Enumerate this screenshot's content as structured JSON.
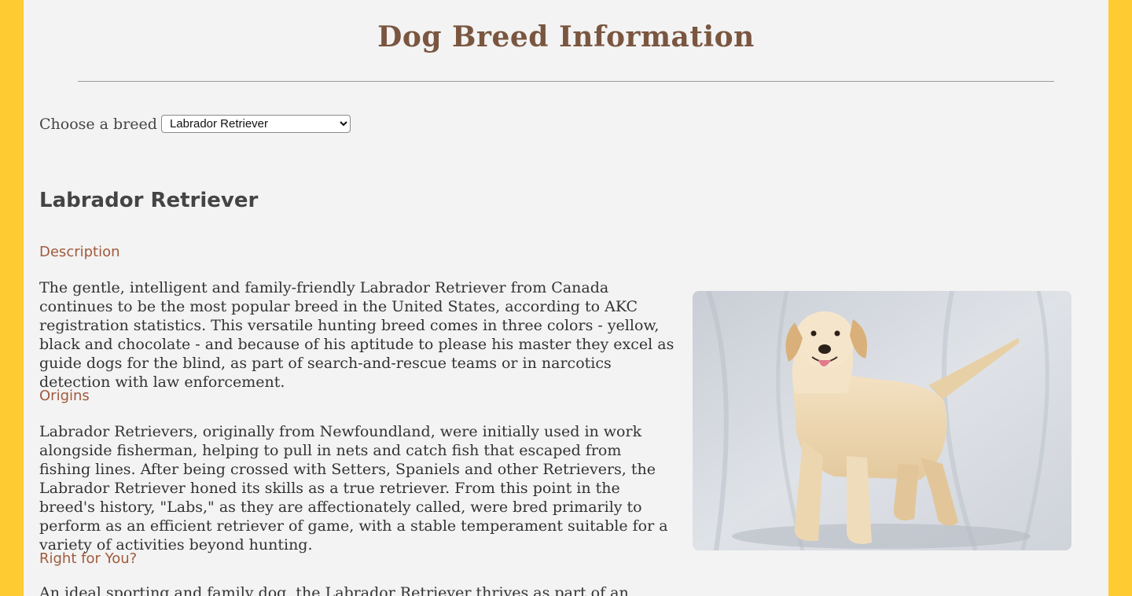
{
  "header": {
    "title": "Dog Breed Information"
  },
  "chooser": {
    "label": "Choose a breed",
    "selected": "Labrador Retriever"
  },
  "breed": {
    "name": "Labrador Retriever",
    "sections": {
      "description": {
        "heading": "Description",
        "body": "The gentle, intelligent and family-friendly Labrador Retriever from Canada continues to be the most popular breed in the United States, according to AKC registration statistics. This versatile hunting breed comes in three colors - yellow, black and chocolate - and because of his aptitude to please his master they excel as guide dogs for the blind, as part of search-and-rescue teams or in narcotics detection with law enforcement."
      },
      "origins": {
        "heading": "Origins",
        "body": "Labrador Retrievers, originally from Newfoundland, were initially used in work alongside fisherman, helping to pull in nets and catch fish that escaped from fishing lines. After being crossed with Setters, Spaniels and other Retrievers, the Labrador Retriever honed its skills as a true retriever. From this point in the breed's history, \"Labs,\" as they are affectionately called, were bred primarily to perform as an efficient retriever of game, with a stable temperament suitable for a variety of activities beyond hunting."
      },
      "right_for_you": {
        "heading": "Right for You?",
        "body": "An ideal sporting and family dog, the Labrador Retriever thrives as part of an active family"
      }
    },
    "photo_icon": "dog-photo"
  },
  "colors": {
    "outer_background": "#fecb33",
    "page_background": "#f3f3f3",
    "title_color": "#7a5640",
    "heading_color": "#a15a3c",
    "text_color": "#333333"
  }
}
